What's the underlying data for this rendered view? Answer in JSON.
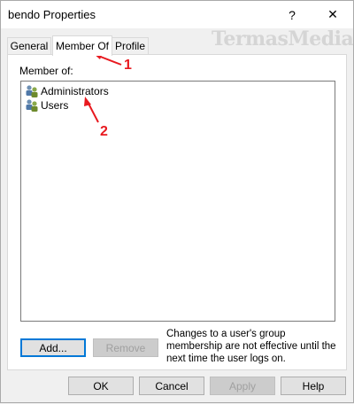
{
  "window": {
    "title": "bendo Properties",
    "help_glyph": "?",
    "close_glyph": "✕"
  },
  "tabs": [
    {
      "label": "General",
      "active": false
    },
    {
      "label": "Member Of",
      "active": true
    },
    {
      "label": "Profile",
      "active": false
    }
  ],
  "member_of": {
    "label": "Member of:",
    "items": [
      {
        "name": "Administrators",
        "icon": "group-icon"
      },
      {
        "name": "Users",
        "icon": "group-icon"
      }
    ]
  },
  "actions": {
    "add_label": "Add...",
    "remove_label": "Remove",
    "note": "Changes to a user's group membership are not effective until the next time the user logs on."
  },
  "footer": {
    "ok_label": "OK",
    "cancel_label": "Cancel",
    "apply_label": "Apply",
    "help_label": "Help"
  },
  "watermark": "TermasMedia",
  "annotations": [
    "1",
    "2"
  ],
  "colors": {
    "annotation": "#e8191f",
    "focus_border": "#0078d7"
  }
}
